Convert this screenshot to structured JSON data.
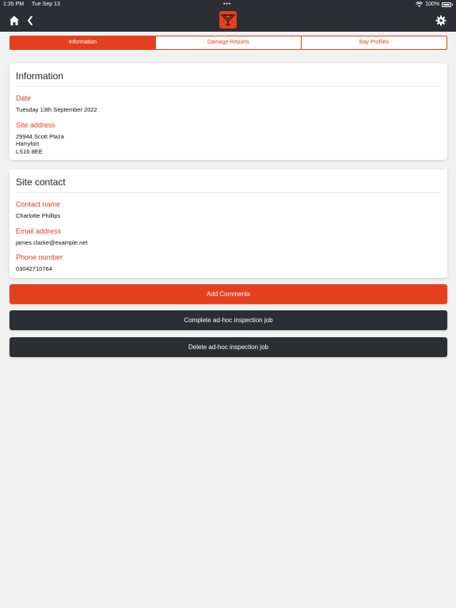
{
  "status": {
    "time": "1:35 PM",
    "date": "Tue Sep 13",
    "dots": "•••",
    "battery": "100%"
  },
  "navbar": {
    "home_icon": "home-icon",
    "back_icon": "back-icon",
    "logo_icon": "brand-logo-icon",
    "settings_icon": "gear-icon"
  },
  "colors": {
    "accent": "#e4401e",
    "dark": "#2b2f33",
    "background": "#f1f1f1"
  },
  "tabs": [
    {
      "label": "Information",
      "active": true
    },
    {
      "label": "Damage Reports",
      "active": false
    },
    {
      "label": "Bay Profiles",
      "active": false
    }
  ],
  "info": {
    "title": "Information",
    "date_label": "Date",
    "date_value": "Tuesday 13th September 2022",
    "address_label": "Site address",
    "address_lines": [
      "29944 Scott Plaza",
      "Harryfort",
      "LS16 8EE"
    ]
  },
  "contact": {
    "title": "Site contact",
    "name_label": "Contact name",
    "name_value": "Charlotte Phillips",
    "email_label": "Email address",
    "email_value": "james.clarke@example.net",
    "phone_label": "Phone number",
    "phone_value": "03042710764"
  },
  "actions": {
    "add_comments": "Add Comments",
    "complete_job": "Complete ad-hoc inspection job",
    "delete_job": "Delete ad-hoc inspection job"
  }
}
